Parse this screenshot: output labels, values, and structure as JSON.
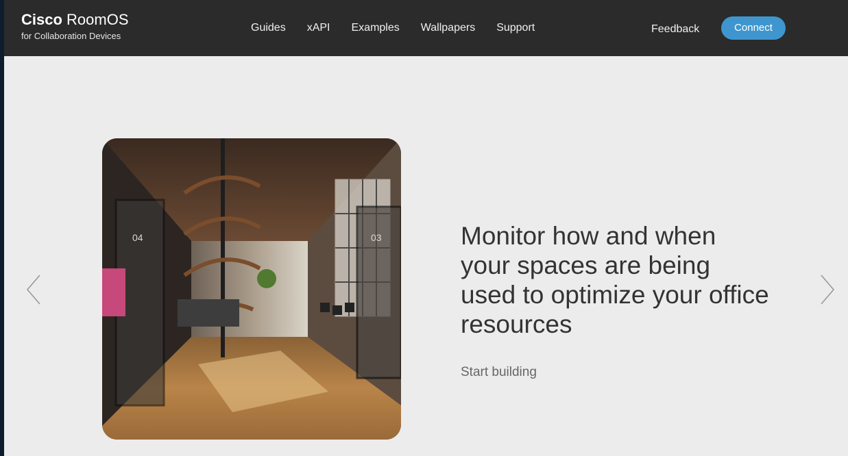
{
  "brand": {
    "name_bold": "Cisco",
    "name_rest": " RoomOS",
    "subtitle": "for Collaboration Devices"
  },
  "nav": {
    "items": [
      "Guides",
      "xAPI",
      "Examples",
      "Wallpapers",
      "Support"
    ],
    "feedback": "Feedback",
    "connect": "Connect"
  },
  "hero": {
    "headline": "Monitor how and when your spaces are being used to optimize your office resources",
    "cta": "Start building",
    "image_labels": [
      "04",
      "03"
    ]
  },
  "carousel": {
    "prev_icon": "chevron-left-icon",
    "next_icon": "chevron-right-icon"
  },
  "colors": {
    "topbar": "#2b2b2b",
    "accent": "#3f96cf",
    "page_bg": "#ececec"
  }
}
